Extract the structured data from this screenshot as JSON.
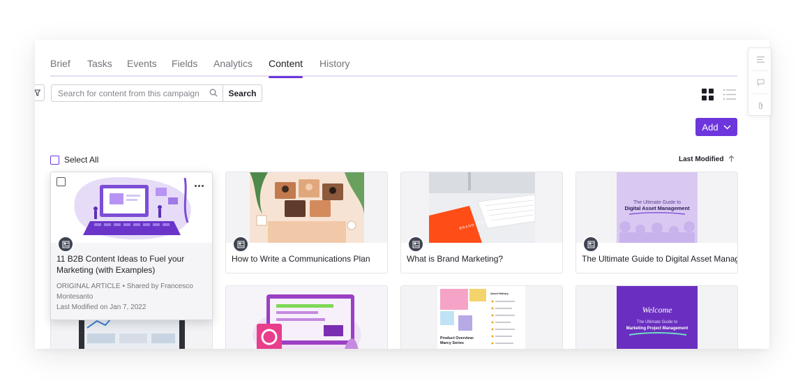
{
  "tabs": [
    {
      "label": "Brief"
    },
    {
      "label": "Tasks"
    },
    {
      "label": "Events"
    },
    {
      "label": "Fields"
    },
    {
      "label": "Analytics"
    },
    {
      "label": "Content",
      "active": true
    },
    {
      "label": "History"
    }
  ],
  "search": {
    "placeholder": "Search for content from this campaign",
    "button": "Search"
  },
  "add_button": {
    "label": "Add"
  },
  "select_all": {
    "label": "Select All"
  },
  "sort": {
    "label": "Last Modified",
    "direction": "ascending"
  },
  "cards": [
    {
      "title": "11 B2B Content Ideas to Fuel your Marketing (with Examples)",
      "meta": "ORIGINAL ARTICLE • Shared by Francesco Montesanto",
      "modified": "Last Modified on Jan 7, 2022",
      "icon": "document-icon"
    },
    {
      "title": "How to Write a Communications Plan",
      "icon": "document-icon"
    },
    {
      "title": "What is Brand Marketing?",
      "icon": "document-icon",
      "image_text": "BRAND IDENTITY"
    },
    {
      "title": "The Ultimate Guide to Digital Asset Management",
      "icon": "document-icon",
      "image_text": "The Ultimate Guide to\nDigital Asset Management"
    }
  ],
  "cards_row2": [
    {
      "image": "dashboard-tablet"
    },
    {
      "image": "web-design-illustration"
    },
    {
      "image_title": "Product Overview:",
      "image_subtitle": "Marcy Series",
      "image_label": "Asset History"
    },
    {
      "image_title": "Welcome",
      "image_subtitle": "The Ultimate Guide to",
      "image_label": "Marketing Project Management"
    }
  ],
  "colors": {
    "accent": "#6d36dc",
    "text": "#1d1d25",
    "muted": "#74747c"
  }
}
